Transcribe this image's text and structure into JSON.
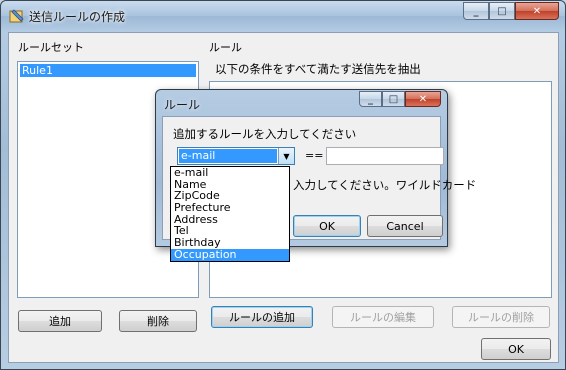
{
  "window": {
    "title": "送信ルールの作成",
    "minimize": "_",
    "maximize": "□",
    "close": "✕"
  },
  "ruleset": {
    "label": "ルールセット",
    "items": [
      "Rule1"
    ],
    "add_label": "追加",
    "delete_label": "削除"
  },
  "rules": {
    "label": "ルール",
    "caption": "以下の条件をすべて満たす送信先を抽出",
    "add_rule_label": "ルールの追加",
    "edit_rule_label": "ルールの編集",
    "delete_rule_label": "ルールの削除",
    "ok_label": "OK"
  },
  "dialog": {
    "title": "ルール",
    "prompt": "追加するルールを入力してください",
    "field_value": "e-mail",
    "operator": "==",
    "value_input": "",
    "note": "入力してください。ワイルドカード",
    "ok_label": "OK",
    "cancel_label": "Cancel",
    "field_options": [
      "e-mail",
      "Name",
      "ZipCode",
      "Prefecture",
      "Address",
      "Tel",
      "Birthday",
      "Occupation"
    ],
    "highlighted_option": "Occupation"
  },
  "colors": {
    "selection": "#3399ff",
    "close_button": "#c0412a"
  }
}
